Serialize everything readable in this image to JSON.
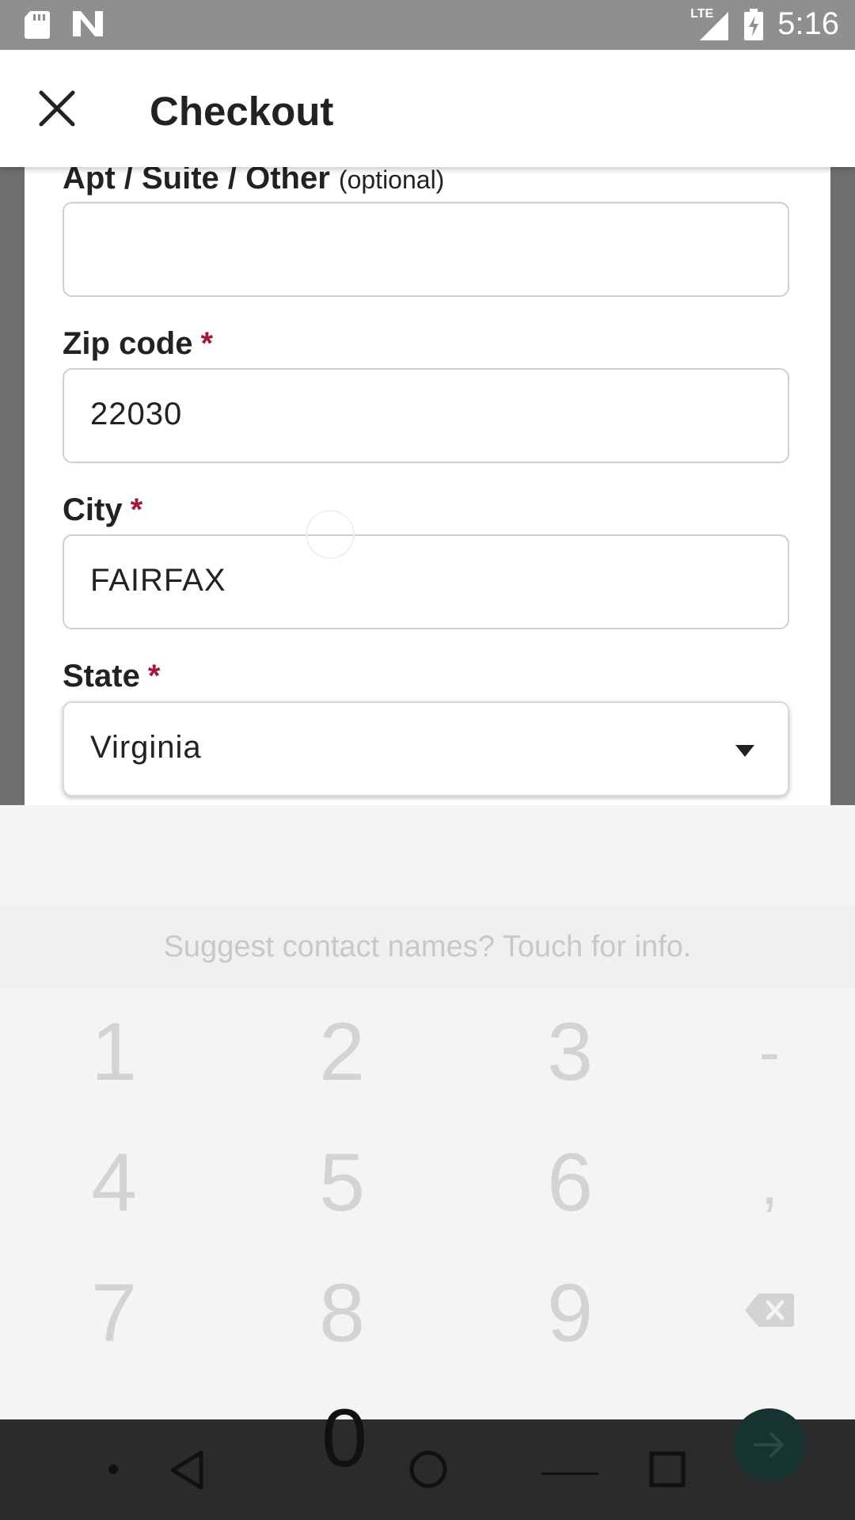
{
  "status_bar": {
    "time": "5:16",
    "network_label": "LTE",
    "icons": [
      "sd-card-icon",
      "notification-n-icon",
      "lte-signal-icon",
      "battery-charging-icon"
    ]
  },
  "header": {
    "title": "Checkout",
    "close_icon": "close-icon"
  },
  "form": {
    "apt": {
      "label": "Apt / Suite / Other",
      "optional": "(optional)",
      "value": ""
    },
    "zip": {
      "label": "Zip code",
      "required": "*",
      "value": "22030"
    },
    "city": {
      "label": "City",
      "required": "*",
      "value": "FAIRFAX"
    },
    "state": {
      "label": "State",
      "required": "*",
      "value": "Virginia"
    }
  },
  "keyboard": {
    "suggestion": "Suggest contact names? Touch for info.",
    "keys": {
      "k1": "1",
      "k2": "2",
      "k3": "3",
      "dash": "-",
      "k4": "4",
      "k5": "5",
      "k6": "6",
      "comma": ",",
      "k7": "7",
      "k8": "8",
      "k9": "9",
      "k0": "0"
    }
  },
  "nav_bar": {
    "icons": [
      "back-icon",
      "home-icon",
      "recents-icon"
    ]
  },
  "colors": {
    "status_bar": "#8f8f8f",
    "required_star": "#a3193a",
    "keyboard_bg": "#f5f4f2",
    "nav_bar": "#2b2b2b",
    "enter_key": "#16332f"
  }
}
